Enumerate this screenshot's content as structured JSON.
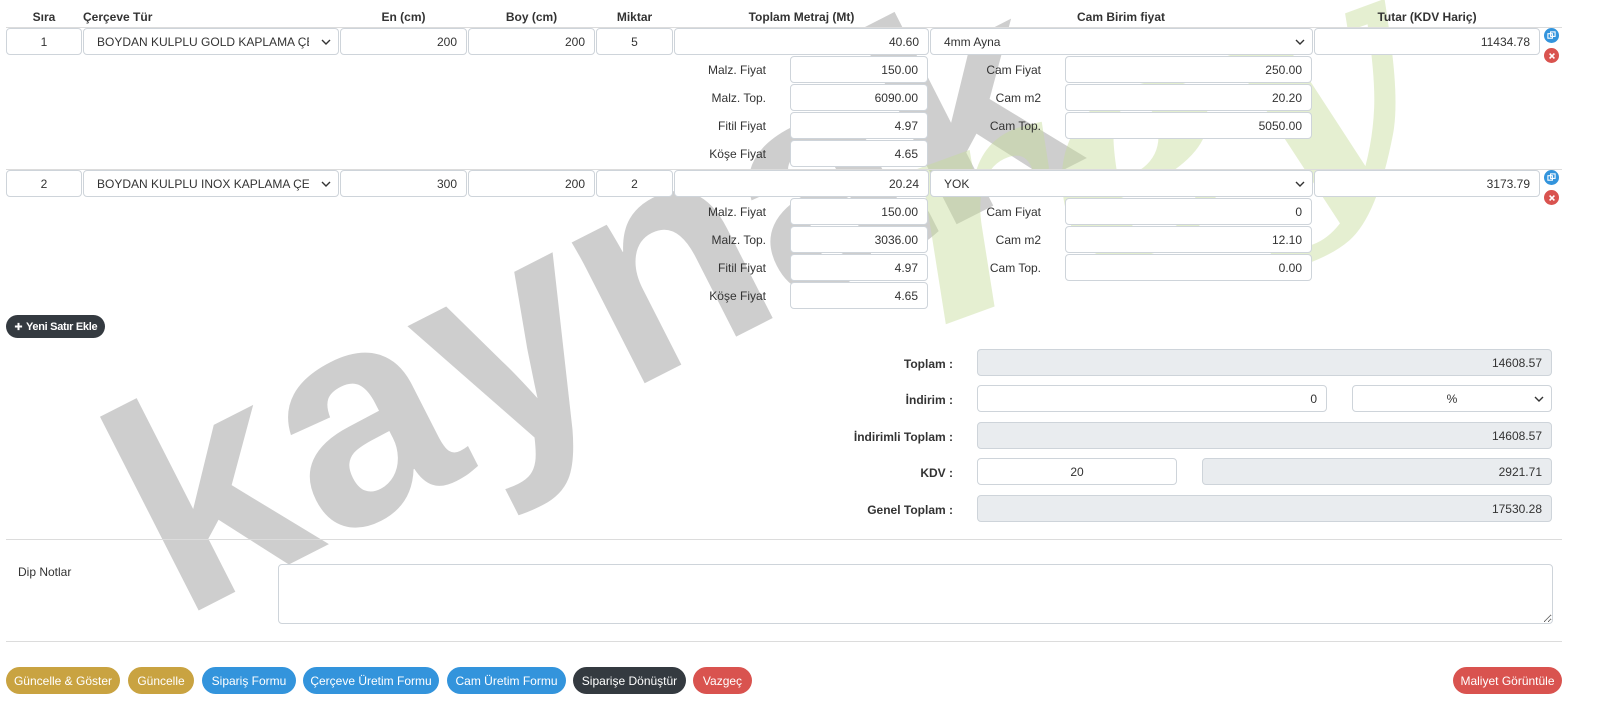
{
  "headers": {
    "sira": "Sıra",
    "cerceve_tur": "Çerçeve Tür",
    "en": "En (cm)",
    "boy": "Boy (cm)",
    "miktar": "Miktar",
    "toplam_metraj": "Toplam Metraj (Mt)",
    "cam_birim_fiyat": "Cam Birim fiyat",
    "tutar": "Tutar (KDV Hariç)"
  },
  "rows": [
    {
      "sira": "1",
      "cerceve": "BOYDAN KULPLU GOLD KAPLAMA ÇERÇEVE",
      "en": "200",
      "boy": "200",
      "miktar": "5",
      "metraj": "40.60",
      "cam": "4mm Ayna",
      "tutar": "11434.78",
      "malz_fiyat": "150.00",
      "malz_top": "6090.00",
      "fitil_fiyat": "4.97",
      "kose_fiyat": "4.65",
      "cam_fiyat": "250.00",
      "cam_m2": "20.20",
      "cam_top": "5050.00"
    },
    {
      "sira": "2",
      "cerceve": "BOYDAN KULPLU INOX KAPLAMA ÇERÇEVE",
      "en": "300",
      "boy": "200",
      "miktar": "2",
      "metraj": "20.24",
      "cam": "YOK",
      "tutar": "3173.79",
      "malz_fiyat": "150.00",
      "malz_top": "3036.00",
      "fitil_fiyat": "4.97",
      "kose_fiyat": "4.65",
      "cam_fiyat": "0",
      "cam_m2": "12.10",
      "cam_top": "0.00"
    }
  ],
  "sublabels": {
    "malz_fiyat": "Malz. Fiyat",
    "malz_top": "Malz. Top.",
    "fitil_fiyat": "Fitil Fiyat",
    "kose_fiyat": "Köşe Fiyat",
    "cam_fiyat": "Cam Fiyat",
    "cam_m2": "Cam m2",
    "cam_top": "Cam Top."
  },
  "add_row_label": "Yeni Satır Ekle",
  "totals": {
    "toplam_label": "Toplam :",
    "toplam": "14608.57",
    "indirim_label": "İndirim :",
    "indirim": "0",
    "indirim_type": "%",
    "indirimli_label": "İndirimli Toplam :",
    "indirimli": "14608.57",
    "kdv_label": "KDV :",
    "kdv_rate": "20",
    "kdv_amount": "2921.71",
    "genel_label": "Genel Toplam :",
    "genel": "17530.28"
  },
  "notes_label": "Dip Notlar",
  "buttons": {
    "guncelle_goster": "Güncelle & Göster",
    "guncelle": "Güncelle",
    "siparis_formu": "Sipariş Formu",
    "cerceve_uretim": "Çerçeve Üretim Formu",
    "cam_uretim": "Cam Üretim Formu",
    "siparise_donustur": "Siparişe Dönüştür",
    "vazgec": "Vazgeç",
    "maliyet": "Maliyet Görüntüle"
  },
  "watermark": {
    "dark_text": "kaynak",
    "light_text": "rey"
  },
  "colors": {
    "gold": "#c9a341",
    "blue": "#3394dc",
    "dark": "#343a40",
    "red": "#d9534f"
  },
  "icons": [
    "copy-icon",
    "delete-icon",
    "chevron-down-icon",
    "plus-icon"
  ]
}
